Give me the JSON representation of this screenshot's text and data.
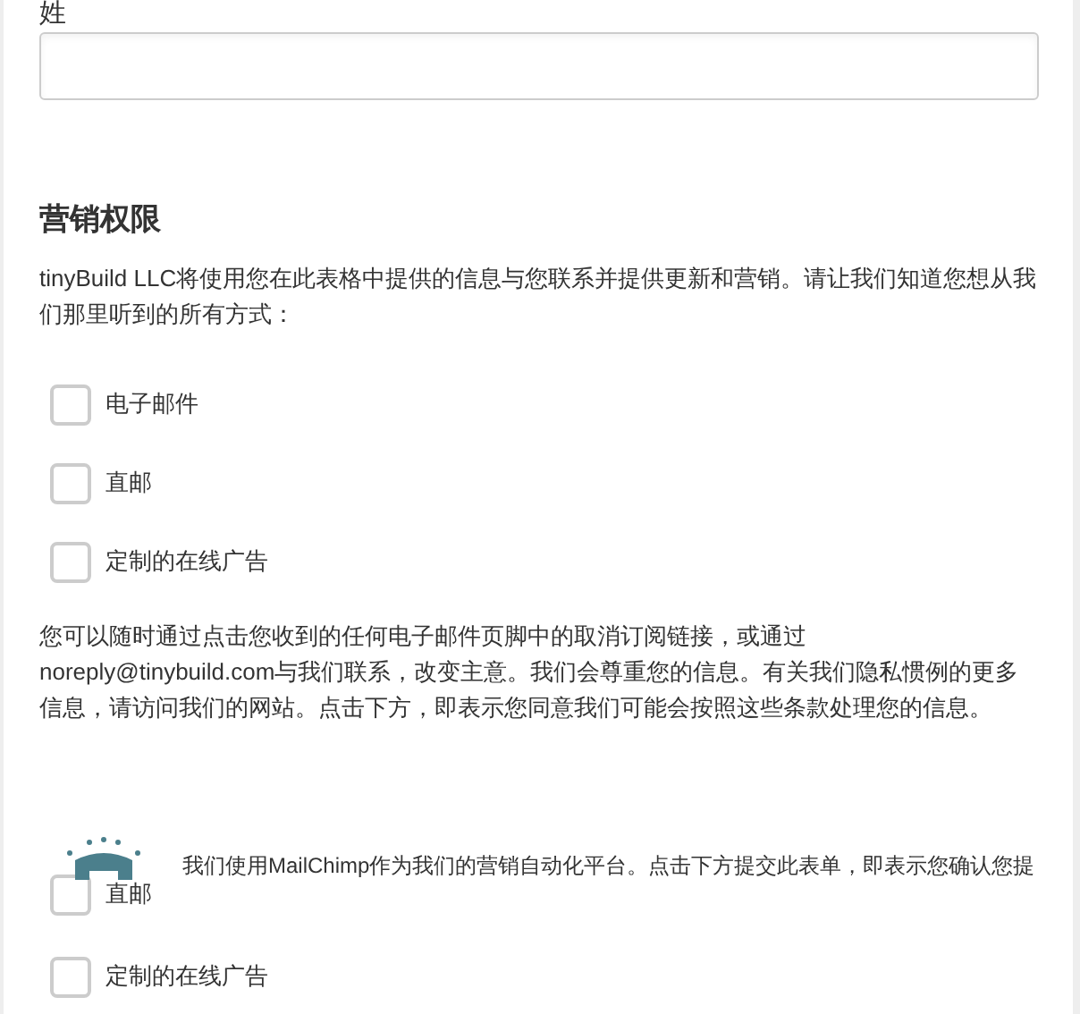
{
  "last_name": {
    "label": "姓"
  },
  "marketing": {
    "heading": "营销权限",
    "intro": "tinyBuild LLC将使用您在此表格中提供的信息与您联系并提供更新和营销。请让我们知道您想从我们那里听到的所有方式：",
    "options": [
      {
        "label": "电子邮件",
        "checked": false
      },
      {
        "label": "直邮",
        "checked": false
      },
      {
        "label": "定制的在线广告",
        "checked": false
      }
    ],
    "notice": "您可以随时通过点击您收到的任何电子邮件页脚中的取消订阅链接，或通过noreply@tinybuild.com与我们联系，改变主意。我们会尊重您的信息。有关我们隐私惯例的更多信息，请访问我们的网站。点击下方，即表示您同意我们可能会按照这些条款处理您的信息。"
  },
  "mailchimp": {
    "text": "我们使用MailChimp作为我们的营销自动化平台。点击下方提交此表单，即表示您确认您提",
    "options": [
      {
        "label": "直邮",
        "checked": false
      },
      {
        "label": "定制的在线广告",
        "checked": false
      }
    ]
  }
}
